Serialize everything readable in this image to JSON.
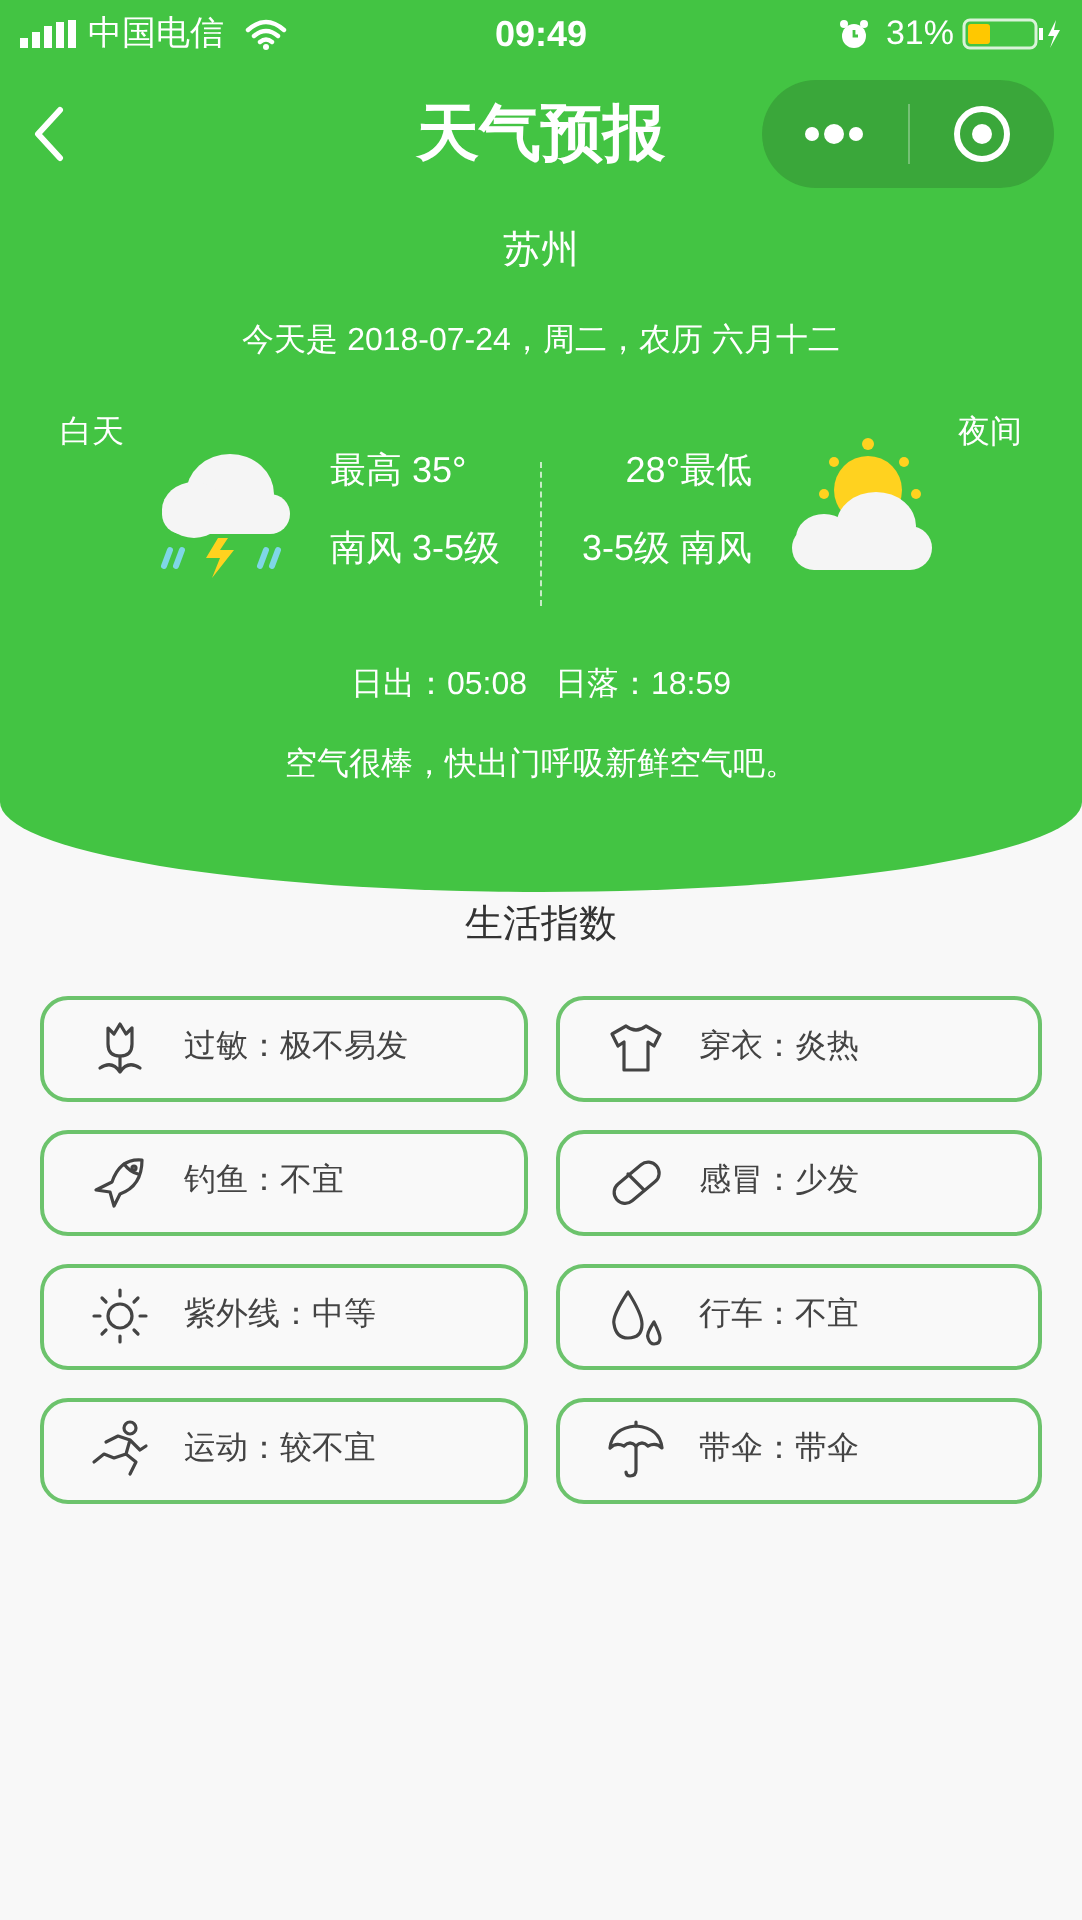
{
  "status_bar": {
    "carrier": "中国电信",
    "time": "09:49",
    "battery": "31%"
  },
  "nav": {
    "title": "天气预报"
  },
  "city": "苏州",
  "date_line": "今天是 2018-07-24，周二，农历 六月十二",
  "day": {
    "label": "白天",
    "kind": "thunderstorm",
    "temp": "最高 35°",
    "wind": "南风 3-5级"
  },
  "night": {
    "label": "夜间",
    "kind": "partly-cloudy",
    "temp": "28°最低",
    "wind": "3-5级 南风"
  },
  "sunrise": "日出：05:08",
  "sunset": "日落：18:59",
  "advice": "空气很棒，快出门呼吸新鲜空气吧。",
  "section_title": "生活指数",
  "indices": [
    {
      "kind": "flower",
      "label": "过敏：极不易发"
    },
    {
      "kind": "shirt",
      "label": "穿衣：炎热"
    },
    {
      "kind": "fish",
      "label": "钓鱼：不宜"
    },
    {
      "kind": "pill",
      "label": "感冒：少发"
    },
    {
      "kind": "sun",
      "label": "紫外线：中等"
    },
    {
      "kind": "drops",
      "label": "行车：不宜"
    },
    {
      "kind": "runner",
      "label": "运动：较不宜"
    },
    {
      "kind": "umbrella",
      "label": "带伞：带伞"
    }
  ]
}
